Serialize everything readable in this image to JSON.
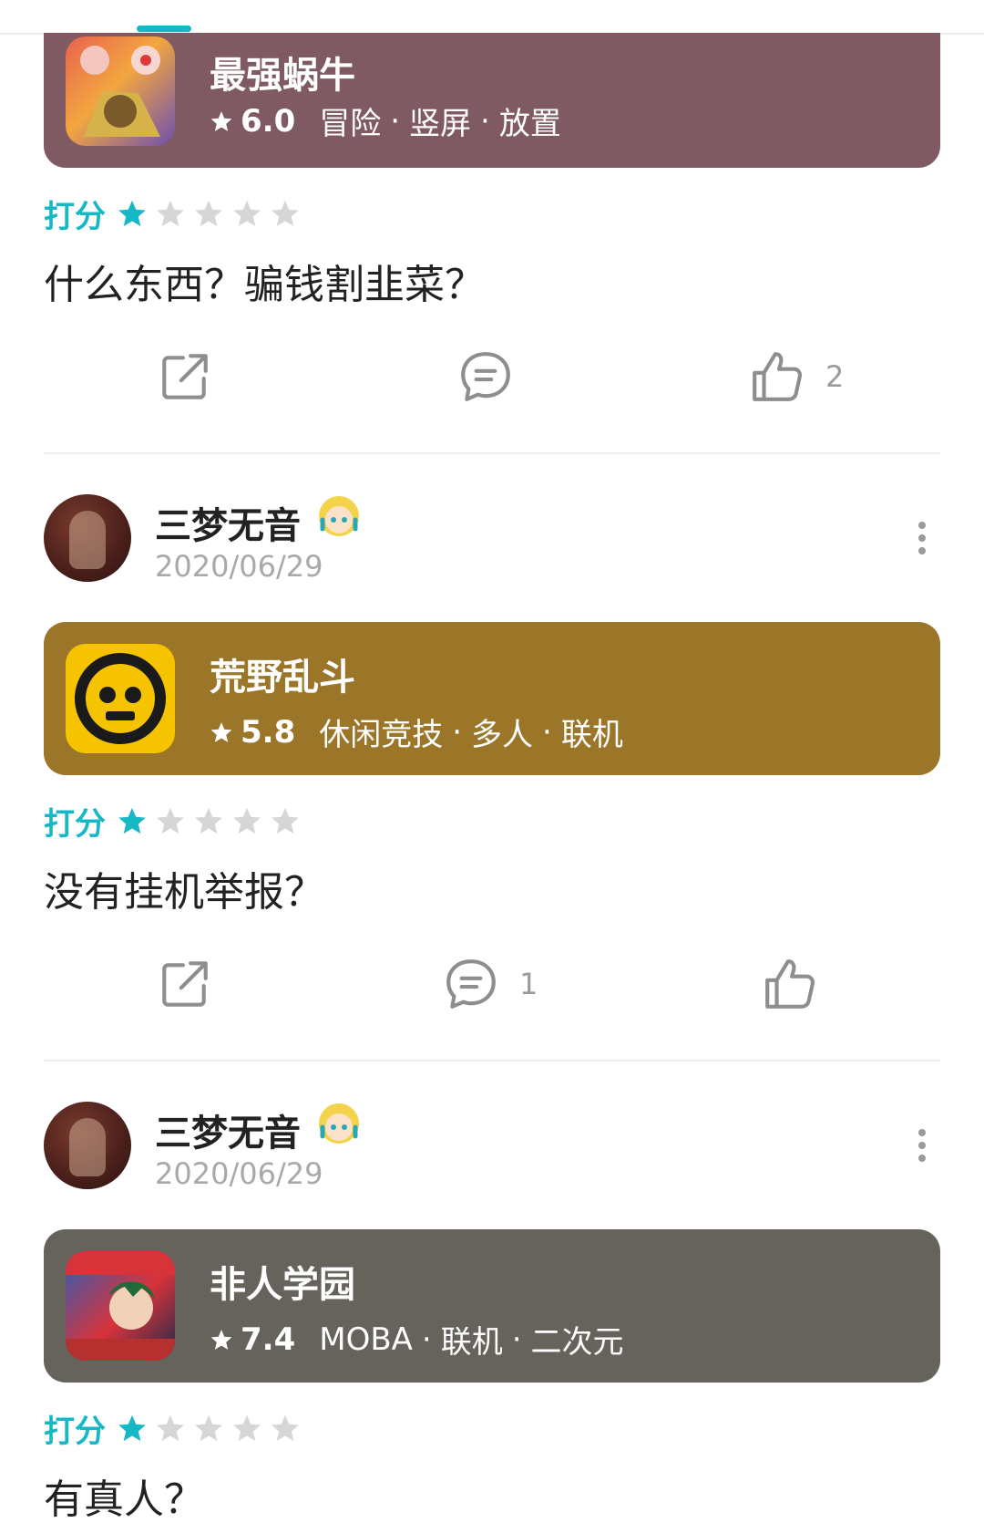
{
  "colors": {
    "accent": "#16b8c6",
    "star_off": "#d6d6d6"
  },
  "reviews": [
    {
      "game": {
        "name": "最强蜗牛",
        "score": "6.0",
        "tags": [
          "冒险",
          "竖屏",
          "放置"
        ],
        "card_color": "#7f5a62"
      },
      "rating_label": "打分",
      "rating": 1,
      "text": "什么东西？骗钱割韭菜？",
      "share_icon": "share-icon",
      "comment_icon": "comment-icon",
      "like_icon": "thumbs-up-icon",
      "comment_count": "",
      "like_count": "2"
    },
    {
      "user": {
        "name": "三梦无音",
        "date": "2020/06/29"
      },
      "game": {
        "name": "荒野乱斗",
        "score": "5.8",
        "tags": [
          "休闲竞技",
          "多人",
          "联机"
        ],
        "card_color": "#9b7629"
      },
      "rating_label": "打分",
      "rating": 1,
      "text": "没有挂机举报？",
      "comment_count": "1",
      "like_count": ""
    },
    {
      "user": {
        "name": "三梦无音",
        "date": "2020/06/29"
      },
      "game": {
        "name": "非人学园",
        "score": "7.4",
        "tags": [
          "MOBA",
          "联机",
          "二次元"
        ],
        "card_color": "#66635c"
      },
      "rating_label": "打分",
      "rating": 1,
      "text": "有真人？"
    }
  ]
}
